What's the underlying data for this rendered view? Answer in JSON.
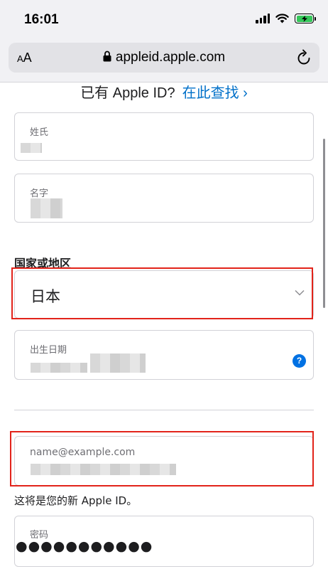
{
  "status_bar": {
    "time": "16:01"
  },
  "browser": {
    "text_size_small": "A",
    "text_size_big": "A",
    "url": "appleid.apple.com"
  },
  "signin": {
    "prompt": "已有 Apple ID?",
    "link": "在此查找 ›"
  },
  "form": {
    "last_name": {
      "label": "姓氏"
    },
    "first_name": {
      "label": "名字"
    },
    "country": {
      "section_label": "国家或地区",
      "selected": "日本"
    },
    "birthday": {
      "label": "出生日期",
      "help_glyph": "?"
    },
    "email": {
      "placeholder": "name@example.com",
      "note": "这将是您的新 Apple ID。"
    },
    "password": {
      "label": "密码",
      "masked_value": "●●●●●●●●●●●"
    }
  },
  "colors": {
    "link": "#0070c9",
    "highlight": "#e2231a",
    "help_badge": "#0071e3",
    "battery": "#34c759"
  },
  "icons": [
    "signal-icon",
    "wifi-icon",
    "battery-charging-icon",
    "lock-icon",
    "reload-icon",
    "chevron-down-icon",
    "help-icon"
  ]
}
